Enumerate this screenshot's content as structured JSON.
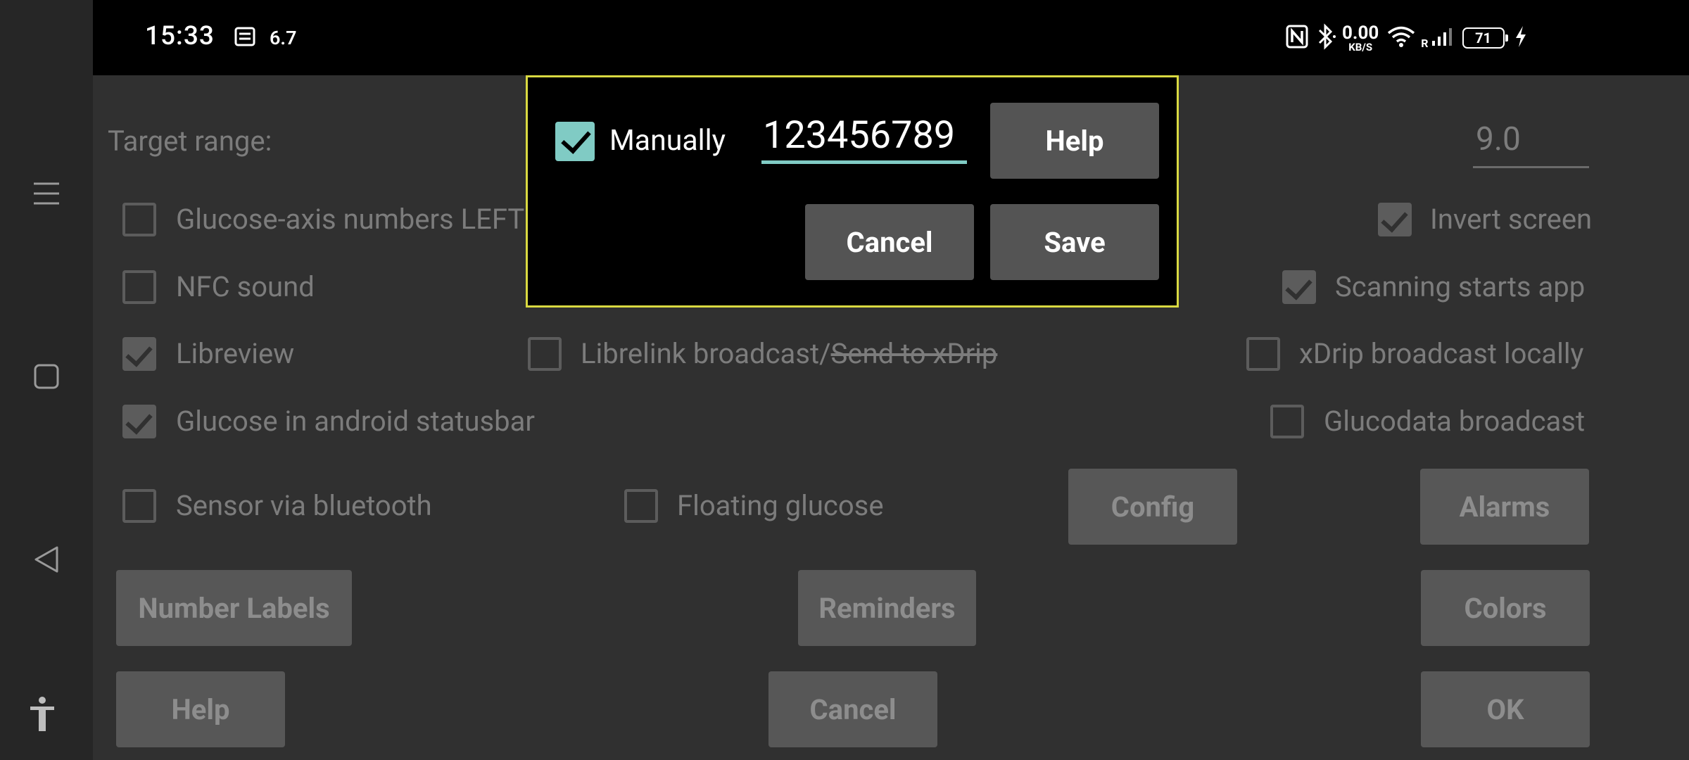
{
  "status_bar": {
    "time": "15:33",
    "signal_value": "6.7",
    "net_speed_value": "0.00",
    "net_speed_unit": "KB/S",
    "roaming": "R",
    "battery": "71"
  },
  "settings": {
    "target_range_label": "Target range:",
    "target_high_value": "9.0",
    "checkboxes": {
      "glucose_axis_left": {
        "label": "Glucose-axis numbers LEFT",
        "checked": false
      },
      "invert_screen": {
        "label": "Invert screen",
        "checked": true
      },
      "nfc_sound": {
        "label": "NFC sound",
        "checked": false
      },
      "scanning_starts_app": {
        "label": "Scanning starts app",
        "checked": true
      },
      "libreview": {
        "label": "Libreview",
        "checked": true
      },
      "librelink_broadcast": {
        "label": "Librelink broadcast/",
        "strike_label": "Send to xDrip",
        "checked": false
      },
      "xdrip_broadcast": {
        "label": "xDrip broadcast locally",
        "checked": false
      },
      "glucose_statusbar": {
        "label": "Glucose in android statusbar",
        "checked": true
      },
      "glucodata_broadcast": {
        "label": "Glucodata broadcast",
        "checked": false
      },
      "sensor_bluetooth": {
        "label": "Sensor via bluetooth",
        "checked": false
      },
      "floating_glucose": {
        "label": "Floating glucose",
        "checked": false
      }
    },
    "buttons": {
      "config": "Config",
      "alarms": "Alarms",
      "number_labels": "Number Labels",
      "reminders": "Reminders",
      "colors": "Colors",
      "help": "Help",
      "cancel": "Cancel",
      "ok": "OK"
    }
  },
  "dialog": {
    "manually_label": "Manually",
    "manually_checked": true,
    "input_value": "123456789",
    "help_label": "Help",
    "cancel_label": "Cancel",
    "save_label": "Save"
  },
  "colors": {
    "accent": "#80cbc4",
    "dialog_border": "#d9d941"
  }
}
